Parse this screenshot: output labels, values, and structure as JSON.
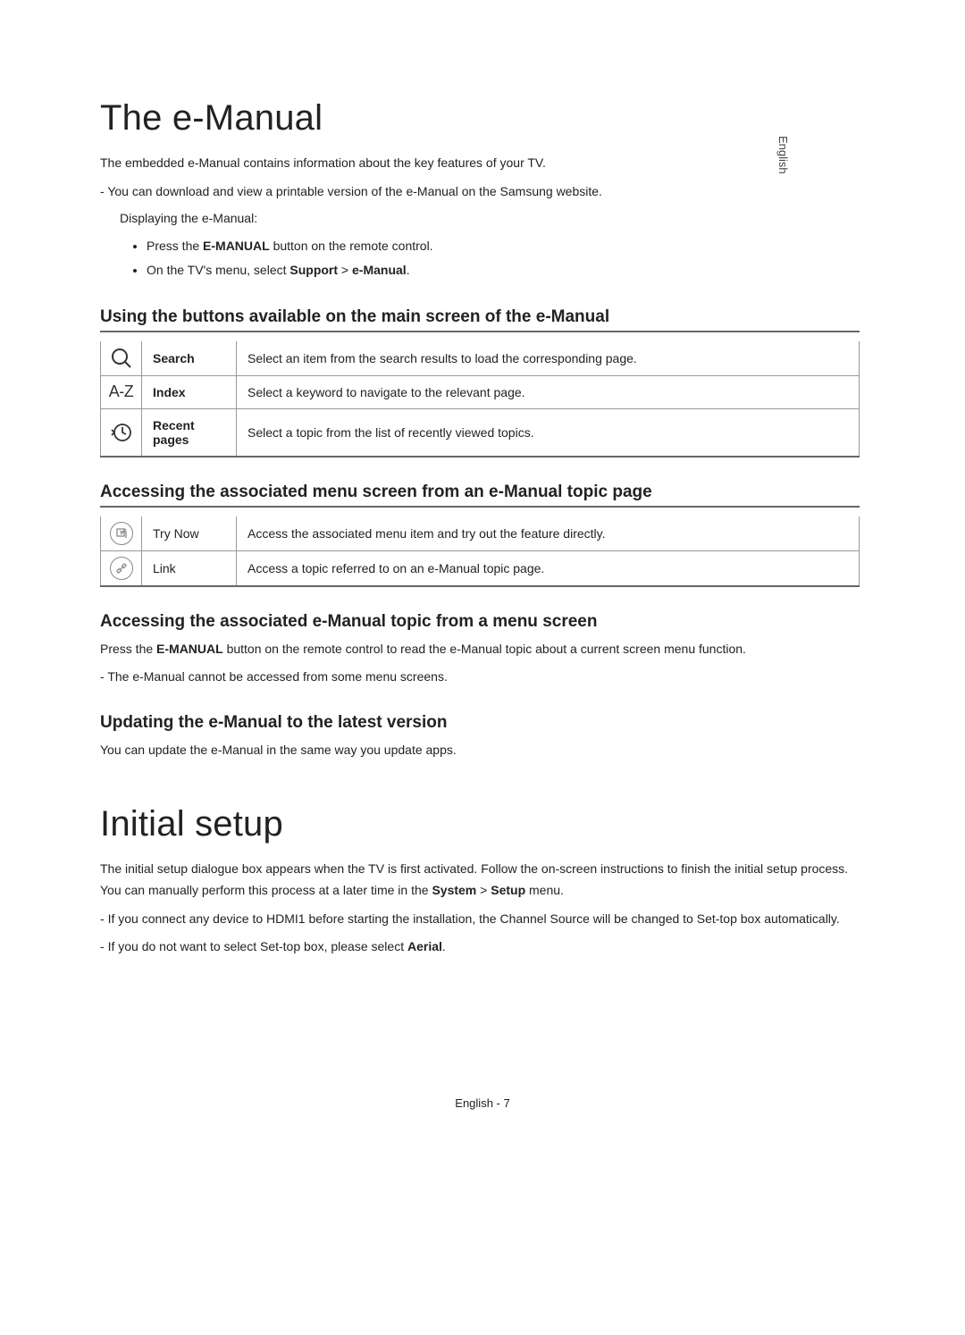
{
  "language_tab": "English",
  "section1": {
    "title": "The e-Manual",
    "intro": "The embedded e-Manual contains information about the key features of your TV.",
    "download_note": "You can download and view a printable version of the e-Manual on the Samsung website.",
    "display_heading": "Displaying the e-Manual:",
    "bullet1_before": "Press the ",
    "bullet1_bold": "E-MANUAL",
    "bullet1_after": " button on the remote control.",
    "bullet2_before": "On the TV's menu, select ",
    "bullet2_bold1": "Support",
    "bullet2_mid": " > ",
    "bullet2_bold2": "e-Manual",
    "bullet2_end": ".",
    "buttons_heading": "Using the buttons available on the main screen of the e-Manual",
    "buttons_table": [
      {
        "label": "Search",
        "desc": "Select an item from the search results to load the corresponding page.",
        "bold": true
      },
      {
        "label": "Index",
        "desc": "Select a keyword to navigate to the relevant page.",
        "bold": true
      },
      {
        "label": "Recent pages",
        "desc": "Select a topic from the list of recently viewed topics.",
        "bold": true
      }
    ],
    "access_heading": "Accessing the associated menu screen from an e-Manual topic page",
    "access_table": [
      {
        "label": "Try Now",
        "desc": "Access the associated menu item and try out the feature directly."
      },
      {
        "label": "Link",
        "desc": "Access a topic referred to on an e-Manual topic page."
      }
    ],
    "from_menu_heading": "Accessing the associated e-Manual topic from a menu screen",
    "from_menu_para_before": "Press the ",
    "from_menu_para_bold": "E-MANUAL",
    "from_menu_para_after": " button on the remote control to read the e-Manual topic about a current screen menu function.",
    "from_menu_note": "The e-Manual cannot be accessed from some menu screens.",
    "update_heading": "Updating the e-Manual to the latest version",
    "update_para": "You can update the e-Manual in the same way you update apps."
  },
  "section2": {
    "title": "Initial setup",
    "para_before": "The initial setup dialogue box appears when the TV is first activated. Follow the on-screen instructions to finish the initial setup process. You can manually perform this process at a later time in the ",
    "para_bold1": "System",
    "para_mid": " > ",
    "para_bold2": "Setup",
    "para_after": " menu.",
    "note1": "If you connect any device to HDMI1 before starting the installation, the Channel Source will be changed to Set-top box automatically.",
    "note2_before": "If you do not want to select Set-top box, please select ",
    "note2_bold": "Aerial",
    "note2_after": "."
  },
  "footer": "English - 7"
}
